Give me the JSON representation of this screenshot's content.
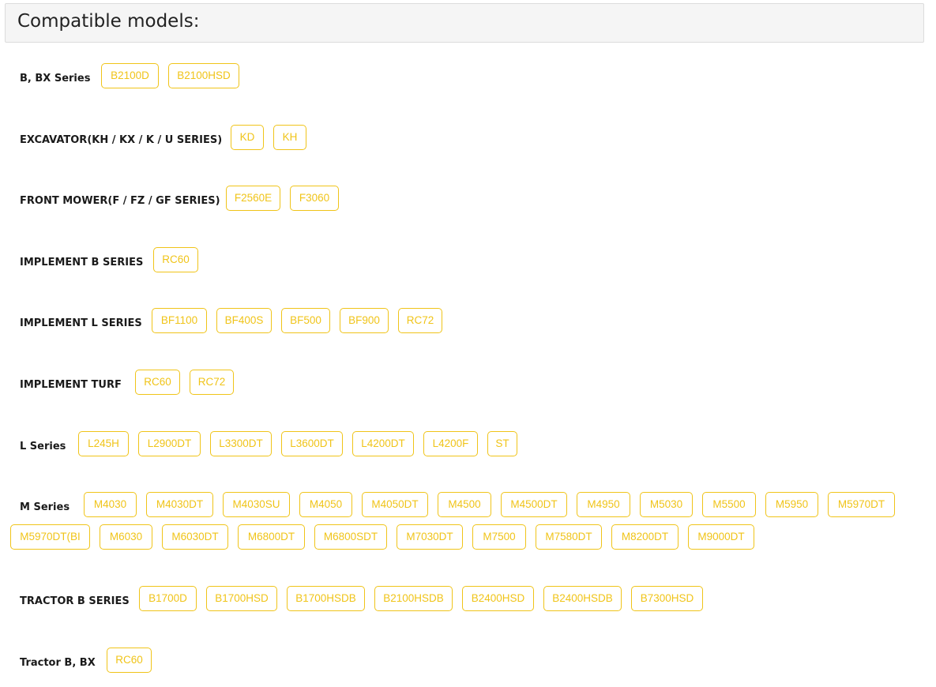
{
  "header": {
    "title": "Compatible models:"
  },
  "series": [
    {
      "label": "B, BX Series",
      "models": [
        "B2100D",
        "B2100HSD"
      ]
    },
    {
      "label": "EXCAVATOR(KH / KX / K / U SERIES)",
      "models": [
        "KD",
        "KH"
      ]
    },
    {
      "label": "FRONT MOWER(F / FZ / GF SERIES)",
      "models": [
        "F2560E",
        "F3060"
      ]
    },
    {
      "label": "IMPLEMENT B SERIES",
      "models": [
        "RC60"
      ]
    },
    {
      "label": "IMPLEMENT L SERIES",
      "models": [
        "BF1100",
        "BF400S",
        "BF500",
        "BF900",
        "RC72"
      ]
    },
    {
      "label": "IMPLEMENT TURF",
      "models": [
        "RC60",
        "RC72"
      ]
    },
    {
      "label": "L Series",
      "models": [
        "L245H",
        "L2900DT",
        "L3300DT",
        "L3600DT",
        "L4200DT",
        "L4200F",
        "ST"
      ]
    },
    {
      "label": "M Series",
      "models": [
        "M4030",
        "M4030DT",
        "M4030SU",
        "M4050",
        "M4050DT",
        "M4500",
        "M4500DT",
        "M4950",
        "M5030",
        "M5500",
        "M5950",
        "M5970DT",
        "M5970DT(BI",
        "M6030",
        "M6030DT",
        "M6800DT",
        "M6800SDT",
        "M7030DT",
        "M7500",
        "M7580DT",
        "M8200DT",
        "M9000DT"
      ]
    },
    {
      "label": "TRACTOR B SERIES",
      "models": [
        "B1700D",
        "B1700HSD",
        "B1700HSDB",
        "B2100HSDB",
        "B2400HSD",
        "B2400HSDB",
        "B7300HSD"
      ]
    },
    {
      "label": "Tractor B, BX",
      "models": [
        "RC60"
      ]
    }
  ]
}
